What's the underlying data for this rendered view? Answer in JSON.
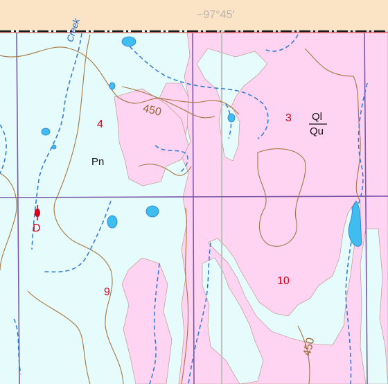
{
  "map": {
    "longitude_label": "−97°45′",
    "stream_name": "Creek",
    "contour_label_elevation": "450",
    "section_numbers": [
      "4",
      "3",
      "9",
      "10"
    ],
    "geologic_units": {
      "permian": "Pn",
      "quaternary_upper": "Ql",
      "quaternary_lower": "Qu"
    },
    "point_label": "D",
    "colors": {
      "permian_bedrock": "#e6fbfb",
      "quaternary_alluvium": "#ffd3f2",
      "margin": "#fbe4c6",
      "section_lines": "#7a5aa6",
      "contours": "#a8753f",
      "streams": "#2c78d6",
      "water": "#3fbdee",
      "labels_red": "#d4001c"
    }
  }
}
